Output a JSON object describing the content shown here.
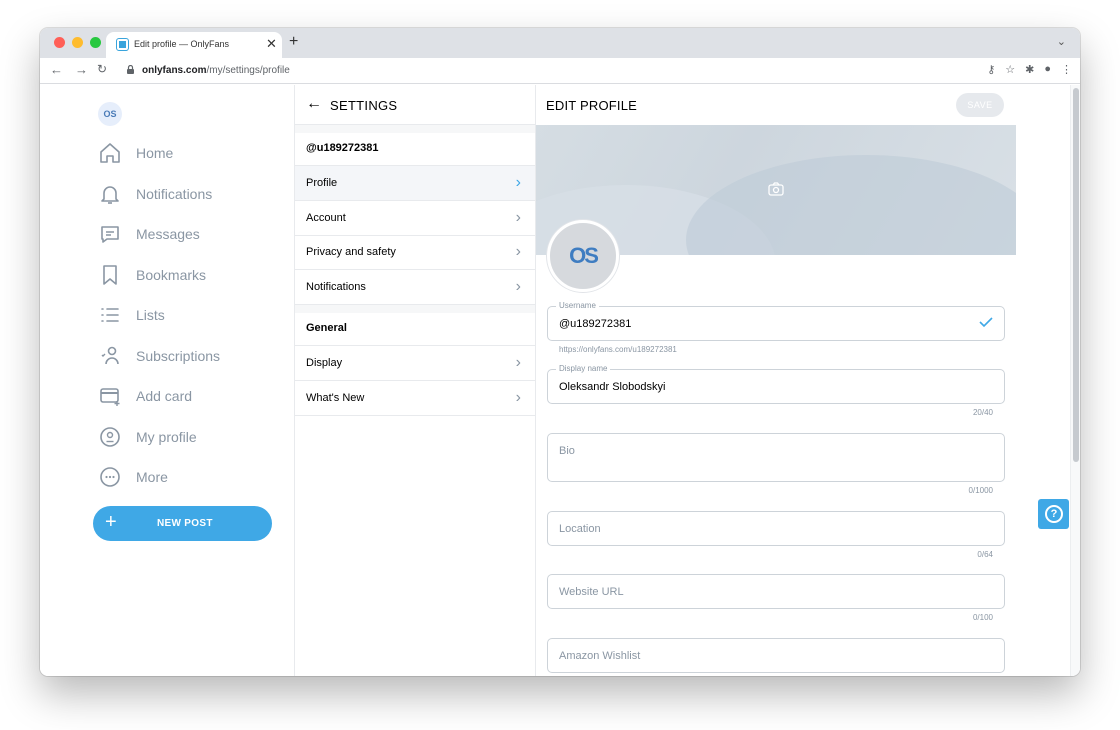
{
  "browser": {
    "tab_title": "Edit profile — OnlyFans",
    "tab_close": "✕",
    "new_tab": "+",
    "url_host": "onlyfans.com",
    "url_path": "/my/settings/profile"
  },
  "leftnav": {
    "avatar_initials": "OS",
    "items": [
      {
        "label": "Home",
        "icon": "home-icon"
      },
      {
        "label": "Notifications",
        "icon": "bell-icon"
      },
      {
        "label": "Messages",
        "icon": "message-icon"
      },
      {
        "label": "Bookmarks",
        "icon": "bookmark-icon"
      },
      {
        "label": "Lists",
        "icon": "list-icon"
      },
      {
        "label": "Subscriptions",
        "icon": "subscriptions-icon"
      },
      {
        "label": "Add card",
        "icon": "card-icon"
      },
      {
        "label": "My profile",
        "icon": "profile-icon"
      },
      {
        "label": "More",
        "icon": "more-icon"
      }
    ],
    "new_post_label": "NEW POST"
  },
  "settings": {
    "title": "SETTINGS",
    "username": "@u189272381",
    "items": [
      {
        "label": "Profile",
        "active": true
      },
      {
        "label": "Account"
      },
      {
        "label": "Privacy and safety"
      },
      {
        "label": "Notifications"
      }
    ],
    "general_header": "General",
    "general_items": [
      {
        "label": "Display"
      },
      {
        "label": "What's New"
      }
    ]
  },
  "edit_profile": {
    "title": "EDIT PROFILE",
    "save_label": "SAVE",
    "avatar_initials": "OS",
    "username": {
      "legend": "Username",
      "value": "@u189272381",
      "hint": "https://onlyfans.com/u189272381"
    },
    "display_name": {
      "legend": "Display name",
      "value": "Oleksandr Slobodskyi",
      "counter": "20/40"
    },
    "bio": {
      "placeholder": "Bio",
      "counter": "0/1000"
    },
    "location": {
      "placeholder": "Location",
      "counter": "0/64"
    },
    "website": {
      "placeholder": "Website URL",
      "counter": "0/100"
    },
    "wishlist": {
      "placeholder": "Amazon Wishlist"
    }
  },
  "colors": {
    "accent": "#3fa8e6",
    "muted_text": "#8a96a3"
  }
}
